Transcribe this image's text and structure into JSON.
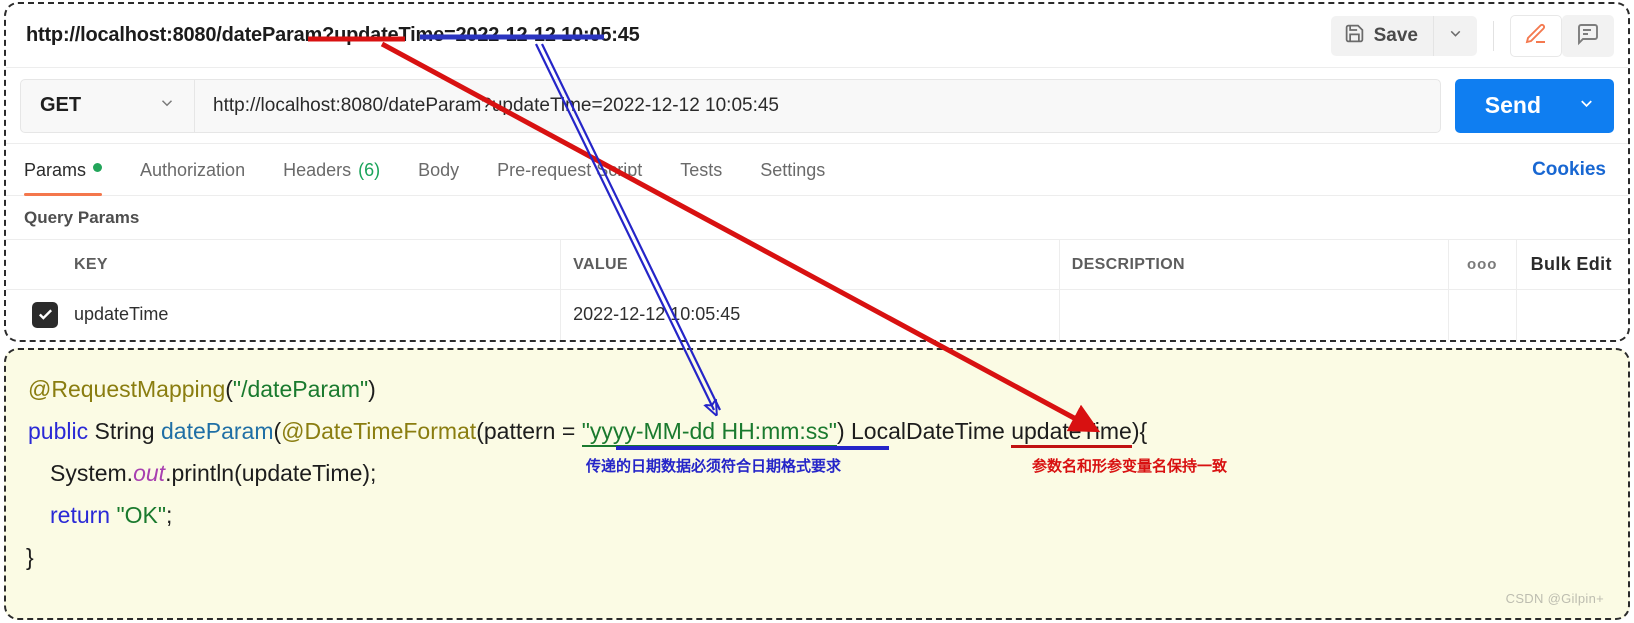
{
  "window": {
    "url_title": "http://localhost:8080/dateParam?updateTime=2022-12-12 10:05:45"
  },
  "toolbar": {
    "save_label": "Save",
    "save_icon": "floppy-disk-icon",
    "save_caret_icon": "chevron-down-icon",
    "edit_icon": "pencil-icon",
    "comment_icon": "comment-icon"
  },
  "request": {
    "method": "GET",
    "method_caret_icon": "chevron-down-icon",
    "url": "http://localhost:8080/dateParam?updateTime=2022-12-12 10:05:45",
    "send_label": "Send",
    "send_caret_icon": "chevron-down-icon"
  },
  "tabs": [
    {
      "label": "Params",
      "badge": "",
      "dot": true,
      "active": true
    },
    {
      "label": "Authorization",
      "badge": "",
      "dot": false,
      "active": false
    },
    {
      "label": "Headers",
      "badge": "(6)",
      "dot": false,
      "active": false
    },
    {
      "label": "Body",
      "badge": "",
      "dot": false,
      "active": false
    },
    {
      "label": "Pre-request Script",
      "badge": "",
      "dot": false,
      "active": false
    },
    {
      "label": "Tests",
      "badge": "",
      "dot": false,
      "active": false
    },
    {
      "label": "Settings",
      "badge": "",
      "dot": false,
      "active": false
    }
  ],
  "cookies_link": "Cookies",
  "params": {
    "section_label": "Query Params",
    "headers": {
      "key": "KEY",
      "value": "VALUE",
      "description": "DESCRIPTION",
      "more_icon": "ooo",
      "bulk_edit": "Bulk Edit"
    },
    "rows": [
      {
        "checked": true,
        "key": "updateTime",
        "value": "2022-12-12 10:05:45",
        "description": ""
      }
    ]
  },
  "code": {
    "line1": {
      "annotation": "@RequestMapping",
      "paren_open": "(",
      "string": "\"/dateParam\"",
      "paren_close": ")"
    },
    "line2": {
      "kw_public": "public",
      "type_string": " String ",
      "method_name": "dateParam",
      "paren_open": "(",
      "annotation": "@DateTimeFormat",
      "paren2": "(pattern = ",
      "pattern": "\"yyyy-MM-dd HH:mm:ss\"",
      "mid": ") LocalDateTime ",
      "param": "updateTime",
      "tail": "){"
    },
    "line3": {
      "prefix": "System.",
      "field": "out",
      "suffix": ".println(updateTime);"
    },
    "line4": {
      "kw_return": "return ",
      "string": "\"OK\"",
      "semi": ";"
    },
    "line5": "}"
  },
  "annotations": {
    "blue_note": "传递的日期数据必须符合日期格式要求",
    "red_note": "参数名和形参变量名保持一致"
  },
  "watermark": "CSDN @Gilpin+",
  "colors": {
    "accent_orange": "#f4774c",
    "send_blue": "#0f7ef1",
    "link_blue": "#1867d2",
    "green_dot": "#23a55a",
    "code_bg": "#fbfbe4",
    "annot_red": "#d81111",
    "annot_blue": "#2525c8"
  }
}
